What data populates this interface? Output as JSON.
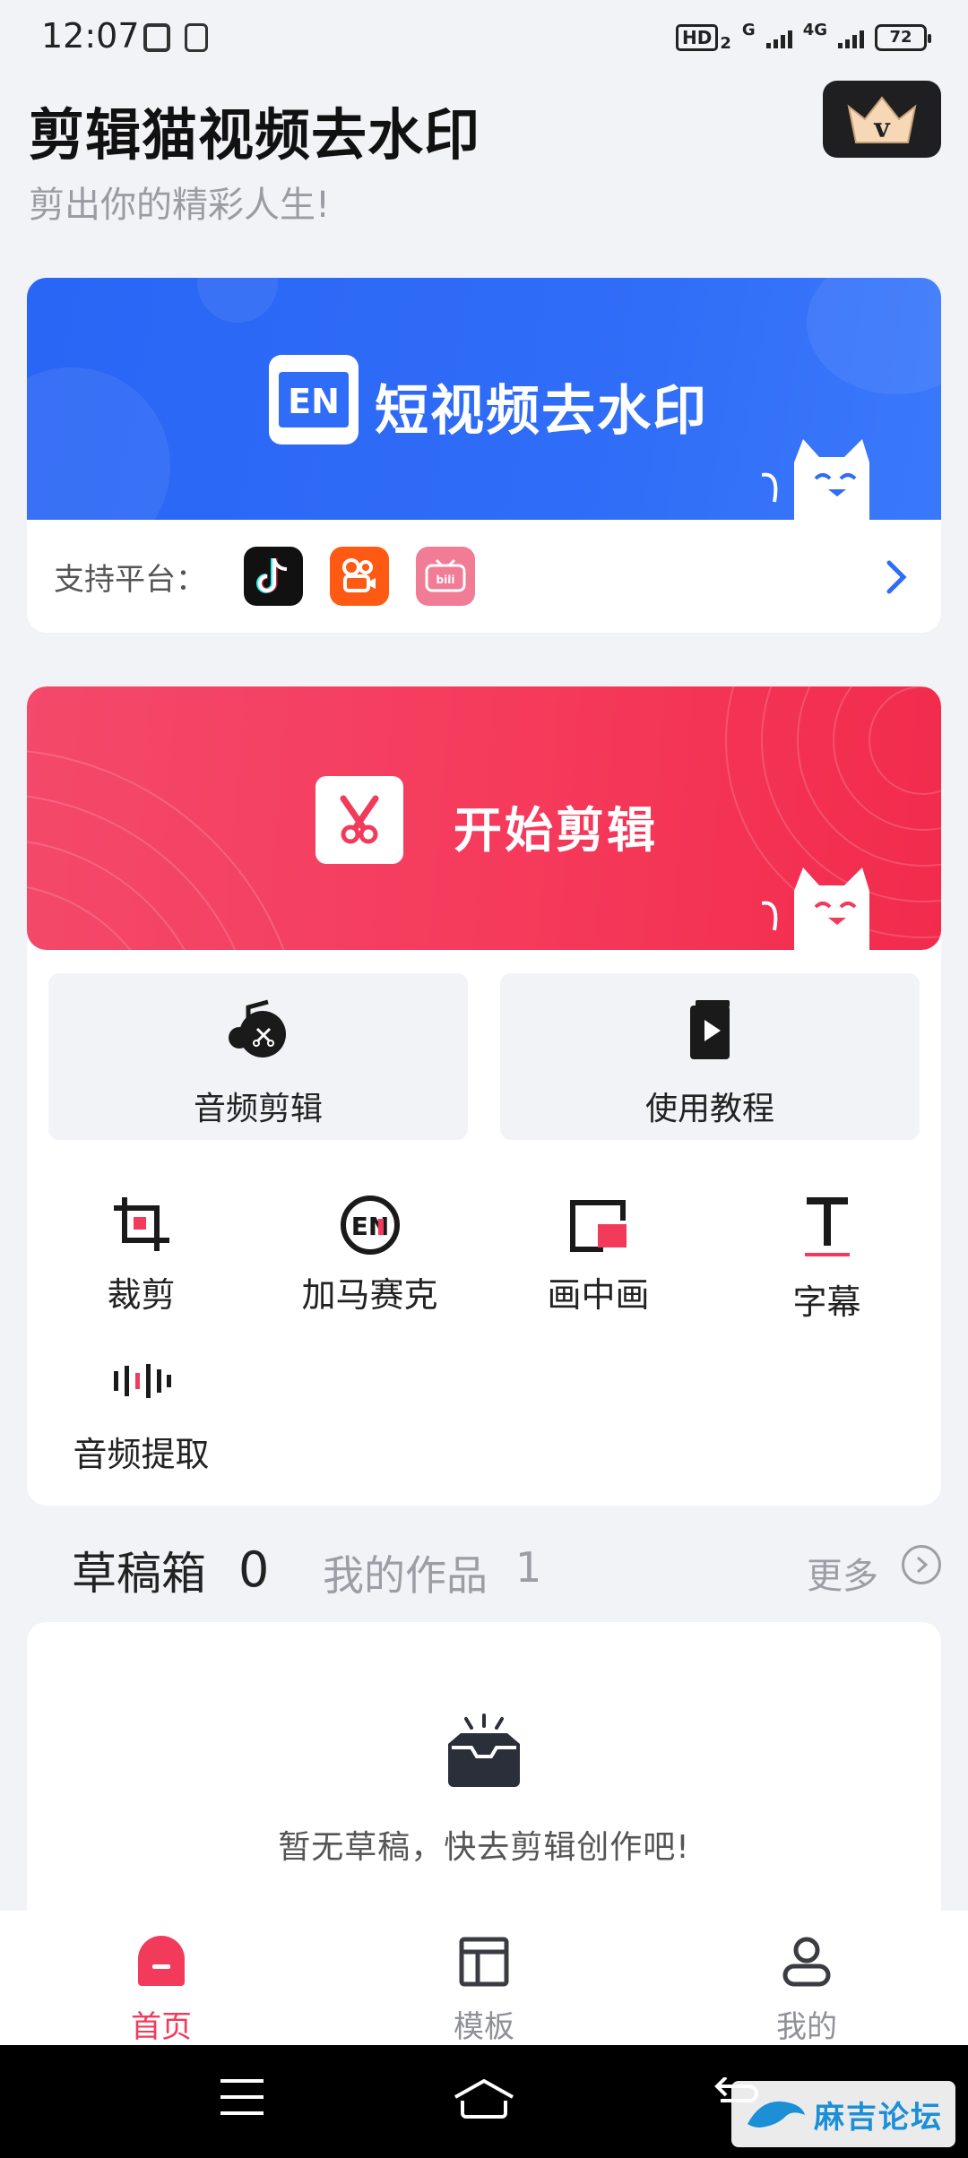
{
  "status_bar": {
    "time": "12:07",
    "network_badge": "HD",
    "network_sub": "2",
    "signal1_label": "G",
    "signal2_label": "4G",
    "battery": "72"
  },
  "header": {
    "title": "剪辑猫视频去水印",
    "subtitle": "剪出你的精彩人生!"
  },
  "watermark_card": {
    "title": "短视频去水印",
    "platforms_label": "支持平台：",
    "platforms": [
      "tiktok-icon",
      "kuaishou-icon",
      "bilibili-icon"
    ],
    "logo_text": "EN"
  },
  "edit_card": {
    "title": "开始剪辑"
  },
  "big_tiles": [
    {
      "label": "音频剪辑",
      "icon": "audio-edit-icon"
    },
    {
      "label": "使用教程",
      "icon": "tutorial-book-icon"
    }
  ],
  "tools": [
    {
      "label": "裁剪",
      "icon": "crop-icon"
    },
    {
      "label": "加马赛克",
      "icon": "mosaic-icon"
    },
    {
      "label": "画中画",
      "icon": "picture-in-picture-icon"
    },
    {
      "label": "字幕",
      "icon": "subtitle-icon"
    },
    {
      "label": "音频提取",
      "icon": "audio-extract-icon"
    }
  ],
  "drafts": {
    "tab_drafts": "草稿箱",
    "drafts_count": "0",
    "tab_works": "我的作品",
    "works_count": "1",
    "more": "更多",
    "empty_text": "暂无草稿，快去剪辑创作吧!"
  },
  "bottom_nav": [
    {
      "label": "首页",
      "active": true
    },
    {
      "label": "模板",
      "active": false
    },
    {
      "label": "我的",
      "active": false
    }
  ],
  "watermark_overlay": "麻吉论坛",
  "colors": {
    "accent": "#f23b5a",
    "blue": "#2f6cf7",
    "background": "#f2f3f7"
  }
}
